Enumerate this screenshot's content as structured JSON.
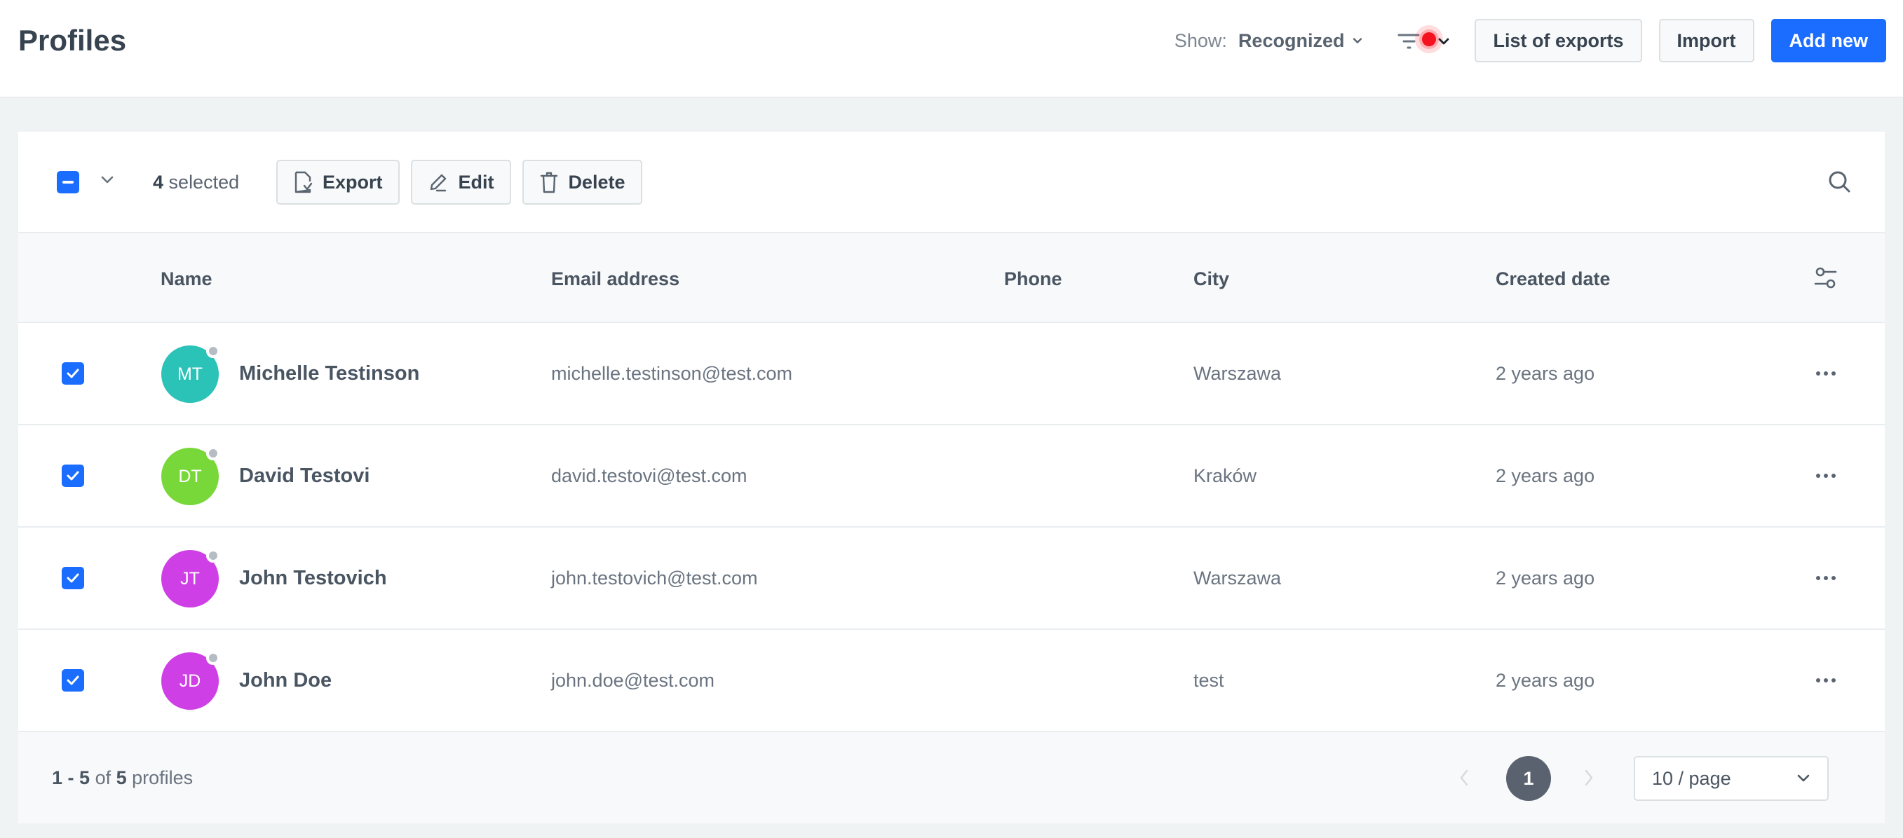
{
  "header": {
    "title": "Profiles",
    "show_label": "Show:",
    "show_value": "Recognized",
    "filter_active": true,
    "buttons": {
      "list_of_exports": "List of exports",
      "import": "Import",
      "add_new": "Add new"
    }
  },
  "toolbar": {
    "selected_count": "4",
    "selected_suffix": "selected",
    "export_label": "Export",
    "edit_label": "Edit",
    "delete_label": "Delete"
  },
  "table": {
    "columns": [
      "Name",
      "Email address",
      "Phone",
      "City",
      "Created date"
    ],
    "rows": [
      {
        "initials": "MT",
        "avatar_color": "#2bc2b8",
        "name": "Michelle Testinson",
        "email": "michelle.testinson@test.com",
        "phone": "",
        "city": "Warszawa",
        "created": "2 years ago",
        "checked": true
      },
      {
        "initials": "DT",
        "avatar_color": "#78d83a",
        "name": "David Testovi",
        "email": "david.testovi@test.com",
        "phone": "",
        "city": "Kraków",
        "created": "2 years ago",
        "checked": true
      },
      {
        "initials": "JT",
        "avatar_color": "#cf3fe6",
        "name": "John Testovich",
        "email": "john.testovich@test.com",
        "phone": "",
        "city": "Warszawa",
        "created": "2 years ago",
        "checked": true
      },
      {
        "initials": "JD",
        "avatar_color": "#cf3fe6",
        "name": "John Doe",
        "email": "john.doe@test.com",
        "phone": "",
        "city": "test",
        "created": "2 years ago",
        "checked": true
      }
    ]
  },
  "footer": {
    "range_start": "1",
    "range_sep": " - ",
    "range_end": "5",
    "of": " of ",
    "total": "5",
    "suffix": " profiles",
    "current_page": "1",
    "page_size": "10 / page"
  },
  "colors": {
    "accent": "#1a6dff",
    "filter_dot": "#f5121f"
  }
}
